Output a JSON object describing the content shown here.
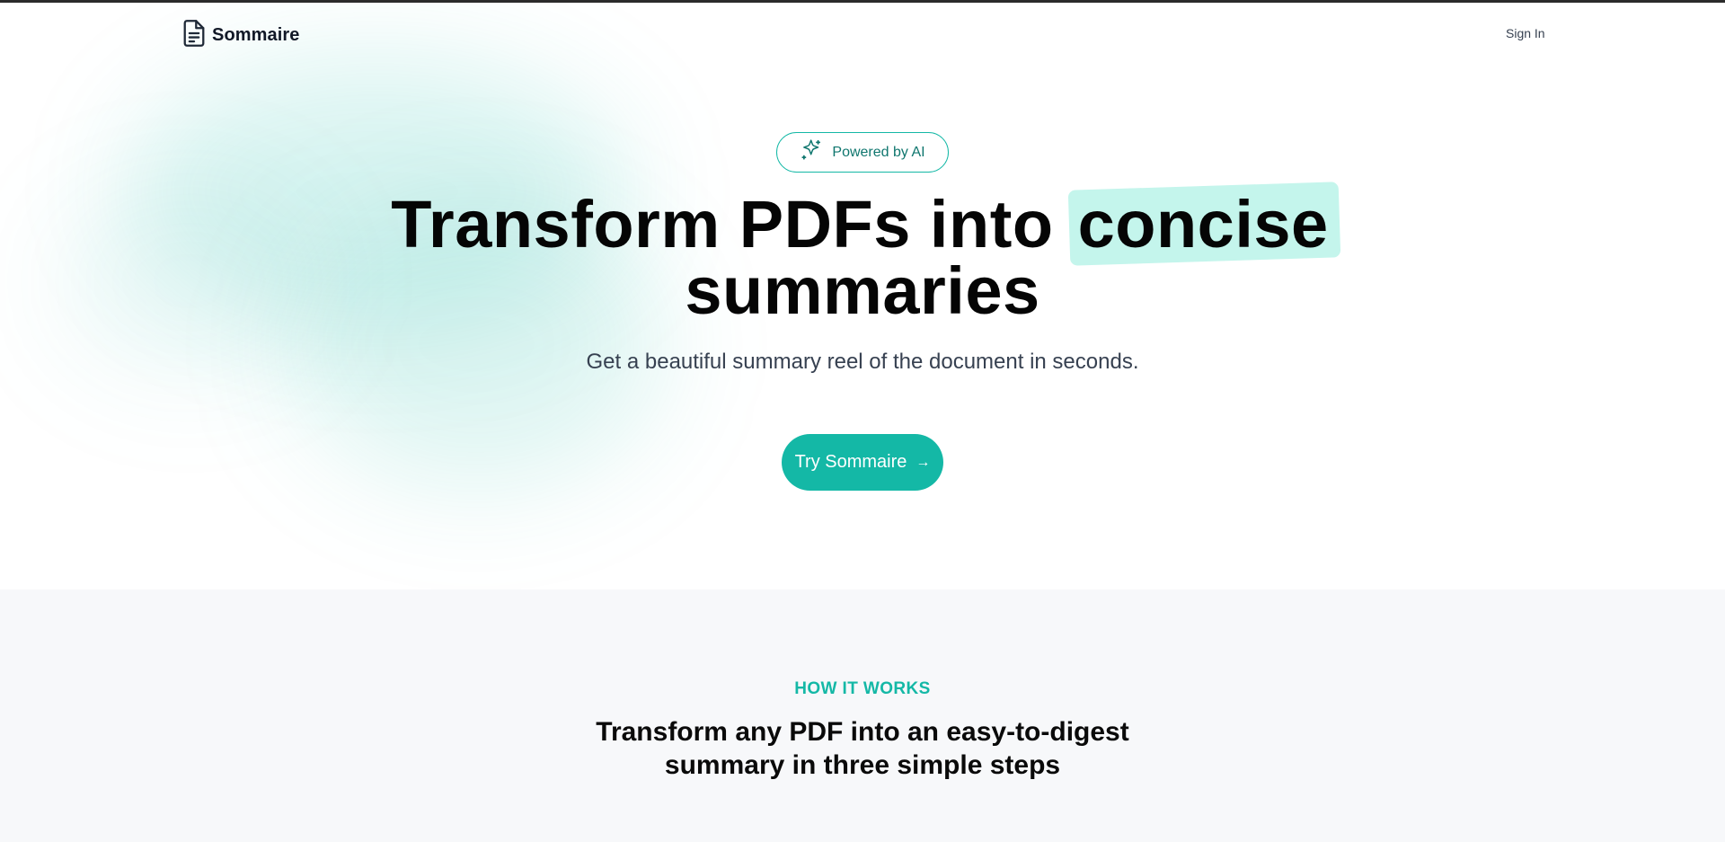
{
  "nav": {
    "brand": "Sommaire",
    "brand_icon": "document-icon",
    "signin_label": "Sign In"
  },
  "hero": {
    "badge_icon": "sparkles-icon",
    "badge_label": "Powered by AI",
    "headline_pre": "Transform PDFs into",
    "headline_highlight": "concise",
    "headline_line2": "summaries",
    "subheadline": "Get a beautiful summary reel of the document in seconds.",
    "cta_label": "Try Sommaire",
    "cta_icon": "arrow-right-icon"
  },
  "how_it_works": {
    "eyebrow": "HOW IT WORKS",
    "title_line1": "Transform any PDF into an easy-to-digest",
    "title_line2": "summary in three simple steps"
  },
  "colors": {
    "accent": "#14b8a6",
    "highlight": "#c4f5ec",
    "section_bg": "#f7f8fa"
  }
}
